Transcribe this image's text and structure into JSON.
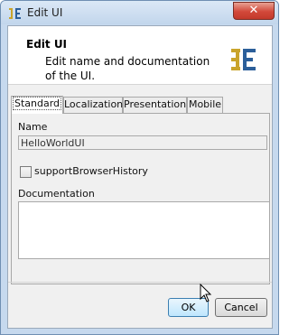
{
  "window": {
    "title": "Edit UI",
    "close_glyph": "✕"
  },
  "header": {
    "title": "Edit UI",
    "description": "Edit name and documentation of the UI.",
    "logo_icon": "app-logo-icon"
  },
  "tabs": [
    {
      "label": "Standard",
      "active": true
    },
    {
      "label": "Localization",
      "active": false
    },
    {
      "label": "Presentation",
      "active": false
    },
    {
      "label": "Mobile",
      "active": false
    }
  ],
  "form": {
    "name_label": "Name",
    "name_value": "HelloWorldUI",
    "browser_history_label": "supportBrowserHistory",
    "browser_history_checked": false,
    "documentation_label": "Documentation",
    "documentation_value": ""
  },
  "buttons": {
    "ok": "OK",
    "cancel": "Cancel"
  },
  "colors": {
    "accent": "#3c7fb1",
    "logo_green": "#c9a42c",
    "logo_blue": "#2c5f9a"
  }
}
